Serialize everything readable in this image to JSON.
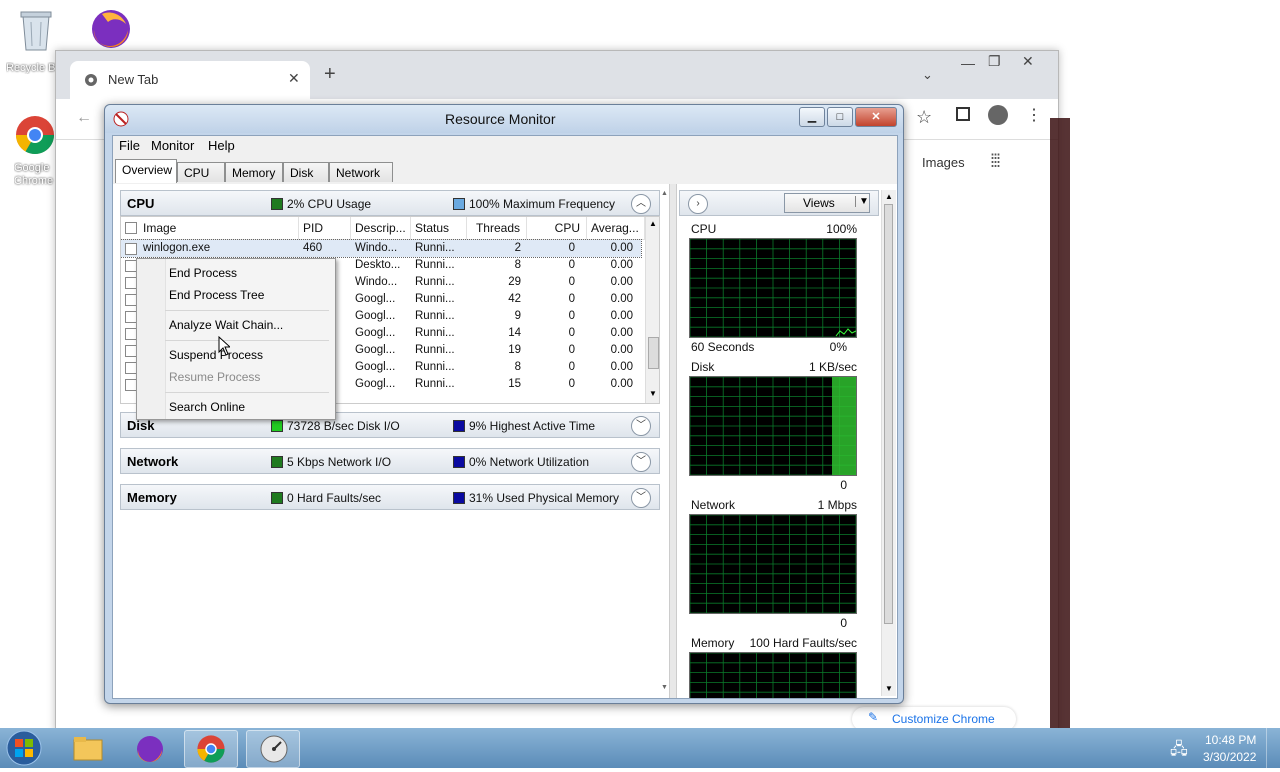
{
  "desktop": {
    "icons": [
      {
        "label": "Recycle Bin",
        "icon": "recycle-bin-icon"
      },
      {
        "label": "Google Chrome",
        "icon": "chrome-icon"
      }
    ]
  },
  "chrome": {
    "tab_title": "New Tab",
    "images_link": "Images",
    "customize_label": "Customize Chrome"
  },
  "resource_monitor": {
    "title": "Resource Monitor",
    "menu": [
      "File",
      "Monitor",
      "Help"
    ],
    "tabs": [
      "Overview",
      "CPU",
      "Memory",
      "Disk",
      "Network"
    ],
    "active_tab": "Overview",
    "cpu_section": {
      "title": "CPU",
      "usage": "2% CPU Usage",
      "frequency": "100% Maximum Frequency",
      "usage_color": "#1f7a1f",
      "freq_color": "#6aa9e0",
      "columns": [
        "Image",
        "PID",
        "Descrip...",
        "Status",
        "Threads",
        "CPU",
        "Averag..."
      ],
      "rows": [
        {
          "image": "winlogon.exe",
          "pid": "460",
          "desc": "Windo...",
          "status": "Runni...",
          "threads": "2",
          "cpu": "0",
          "avg": "0.00"
        },
        {
          "image": "",
          "pid": "",
          "desc": "Deskto...",
          "status": "Runni...",
          "threads": "8",
          "cpu": "0",
          "avg": "0.00"
        },
        {
          "image": "",
          "pid": "",
          "desc": "Windo...",
          "status": "Runni...",
          "threads": "29",
          "cpu": "0",
          "avg": "0.00"
        },
        {
          "image": "",
          "pid": "",
          "desc": "Googl...",
          "status": "Runni...",
          "threads": "42",
          "cpu": "0",
          "avg": "0.00"
        },
        {
          "image": "",
          "pid": "",
          "desc": "Googl...",
          "status": "Runni...",
          "threads": "9",
          "cpu": "0",
          "avg": "0.00"
        },
        {
          "image": "",
          "pid": "",
          "desc": "Googl...",
          "status": "Runni...",
          "threads": "14",
          "cpu": "0",
          "avg": "0.00"
        },
        {
          "image": "",
          "pid": "",
          "desc": "Googl...",
          "status": "Runni...",
          "threads": "19",
          "cpu": "0",
          "avg": "0.00"
        },
        {
          "image": "",
          "pid": "",
          "desc": "Googl...",
          "status": "Runni...",
          "threads": "8",
          "cpu": "0",
          "avg": "0.00"
        },
        {
          "image": "",
          "pid": "",
          "desc": "Googl...",
          "status": "Runni...",
          "threads": "15",
          "cpu": "0",
          "avg": "0.00"
        }
      ]
    },
    "disk_section": {
      "title": "Disk",
      "io": "73728 B/sec Disk I/O",
      "active": "9% Highest Active Time",
      "io_color": "#22cc22",
      "active_color": "#0a0aa0"
    },
    "network_section": {
      "title": "Network",
      "io": "5 Kbps Network I/O",
      "util": "0% Network Utilization",
      "io_color": "#1f7a1f",
      "util_color": "#0a0aa0"
    },
    "memory_section": {
      "title": "Memory",
      "faults": "0 Hard Faults/sec",
      "used": "31% Used Physical Memory",
      "faults_color": "#1f7a1f",
      "used_color": "#0a0aa0"
    },
    "context_menu": [
      "End Process",
      "End Process Tree",
      "Analyze Wait Chain...",
      "Suspend Process",
      "Resume Process",
      "Search Online"
    ],
    "views_label": "Views",
    "graphs": [
      {
        "name": "CPU",
        "max": "100%",
        "footer_left": "60 Seconds",
        "footer_right": "0%"
      },
      {
        "name": "Disk",
        "max": "1 KB/sec",
        "footer_left": "",
        "footer_right": "0"
      },
      {
        "name": "Network",
        "max": "1 Mbps",
        "footer_left": "",
        "footer_right": "0"
      },
      {
        "name": "Memory",
        "max": "100 Hard Faults/sec",
        "footer_left": "",
        "footer_right": ""
      }
    ]
  },
  "taskbar": {
    "time": "10:48 PM",
    "date": "3/30/2022"
  }
}
